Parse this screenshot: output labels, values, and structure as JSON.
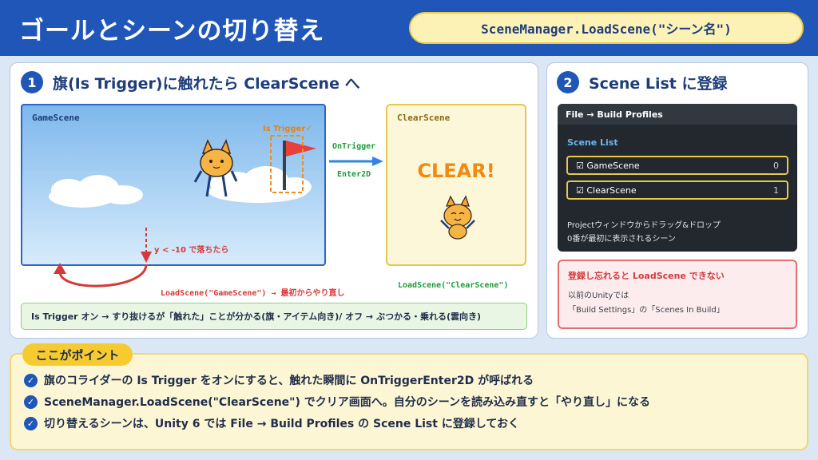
{
  "header": {
    "title": "ゴールとシーンの切り替え",
    "api_pill": "SceneManager.LoadScene(\"シーン名\")"
  },
  "step1": {
    "number": "1",
    "title": "旗(Is Trigger)に触れたら ClearScene へ",
    "game_scene_label": "GameScene",
    "is_trigger_label": "Is Trigger✓",
    "fall_label": "y < -10 で落ちたら",
    "reload_label": "LoadScene(\"GameScene\") → 最初からやり直し",
    "trigger_top": "OnTrigger",
    "trigger_bottom": "Enter2D",
    "clear_scene_label": "ClearScene",
    "clear_text": "CLEAR!",
    "load_clear_label": "LoadScene(\"ClearScene\")",
    "note": "Is Trigger オン → すり抜けるが「触れた」ことが分かる(旗・アイテム向き)/ オフ → ぶつかる・乗れる(雲向き)"
  },
  "step2": {
    "number": "2",
    "title": "Scene List に登録",
    "panel_header": "File → Build Profiles",
    "list_title": "Scene List",
    "scenes": [
      {
        "name": "☑ GameScene",
        "index": "0"
      },
      {
        "name": "☑ ClearScene",
        "index": "1"
      }
    ],
    "note1": "Projectウィンドウからドラッグ&ドロップ",
    "note2": "0番が最初に表示されるシーン",
    "warning_title": "登録し忘れると LoadScene できない",
    "warning_line1": "以前のUnityでは",
    "warning_line2": "「Build Settings」の「Scenes In Build」"
  },
  "points": {
    "tag": "ここがポイント",
    "items": [
      "旗のコライダーの Is Trigger をオンにすると、触れた瞬間に OnTriggerEnter2D が呼ばれる",
      "SceneManager.LoadScene(\"ClearScene\") でクリア画面へ。自分のシーンを読み込み直すと「やり直し」になる",
      "切り替えるシーンは、Unity 6 では File → Build Profiles の Scene List に登録しておく"
    ]
  },
  "colors": {
    "header_blue": "#1f56b8",
    "trigger_green": "#1f9a3b",
    "reload_red": "#d63a38",
    "clear_orange": "#f28a12"
  }
}
